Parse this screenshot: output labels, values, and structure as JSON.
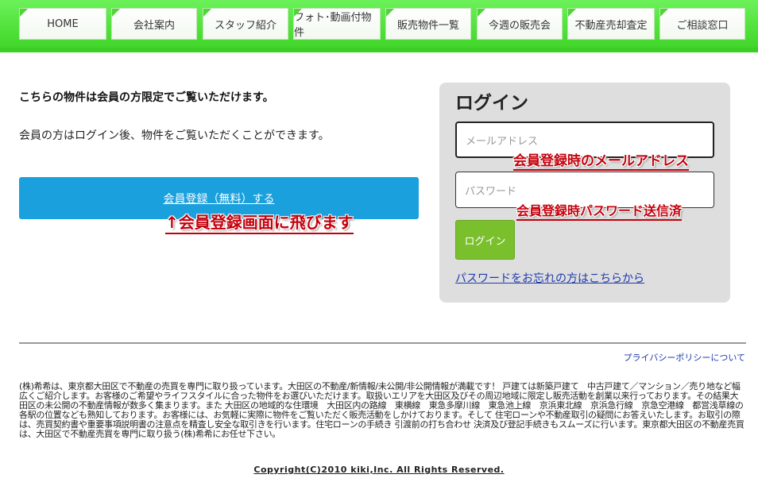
{
  "nav": {
    "items": [
      {
        "label": "HOME"
      },
      {
        "label": "会社案内"
      },
      {
        "label": "スタッフ紹介"
      },
      {
        "label": "フォト･動画付物件"
      },
      {
        "label": "販売物件一覧"
      },
      {
        "label": "今週の販売会"
      },
      {
        "label": "不動産売却査定"
      },
      {
        "label": "ご相談窓口"
      }
    ]
  },
  "main": {
    "notice_bold": "こちらの物件は会員の方限定でご覧いただけます。",
    "notice_text": "会員の方はログイン後、物件をご覧いただくことができます。",
    "register_label": "会員登録（無料）する",
    "annotation_register": "↑会員登録画面に飛びます"
  },
  "login": {
    "title": "ログイン",
    "email_placeholder": "メールアドレス",
    "password_placeholder": "パスワード",
    "annotation_email": "会員登録時のメールアドレス",
    "annotation_password": "会員登録時パスワード送信済",
    "button_label": "ログイン",
    "forgot_link": "パスワードをお忘れの方はこちらから"
  },
  "footer": {
    "privacy_link": "プライバシーポリシーについて",
    "description": "(株)希希は、東京都大田区で不動産の売買を専門に取り扱っています。大田区の不動産/新情報/未公開/非公開情報が満載です！ 戸建ては新築戸建て　中古戸建て／マンション／売り地など幅広くご紹介します。お客様のご希望やライフスタイルに合った物件をお選びいただけます。取扱いエリアを大田区及びその周辺地域に限定し販売活動を創業以来行っております。その結果大田区の未公開の不動産情報が数多く集まります。また 大田区の地域的な住環境　大田区内の路線　東横線　東急多摩川線　東急池上線　京浜東北線　京浜急行線　京急空港線　都営浅草線の各駅の位置なども熟知しております。お客様には、お気軽に実際に物件をご覧いただく販売活動をしかけております。そして 住宅ローンや不動産取引の疑問にお答えいたします。お取引の際は、売買契約書や重要事項説明書の注意点を精査し安全な取引きを行います。住宅ローンの手続き 引渡前の打ち合わせ 決済及び登記手続きもスムーズに行います。東京都大田区の不動産売買は、大田区で不動産売買を専門に取り扱う(株)希希にお任せ下さい。",
    "copyright": "Copyright(C)2010 kiki,Inc. All Rights Reserved."
  },
  "colors": {
    "nav_green": "#4fe038",
    "register_blue": "#1aa0dc",
    "login_green": "#7ac02c",
    "annotation_red": "#c4000c",
    "link_blue": "#1f3aaf"
  }
}
